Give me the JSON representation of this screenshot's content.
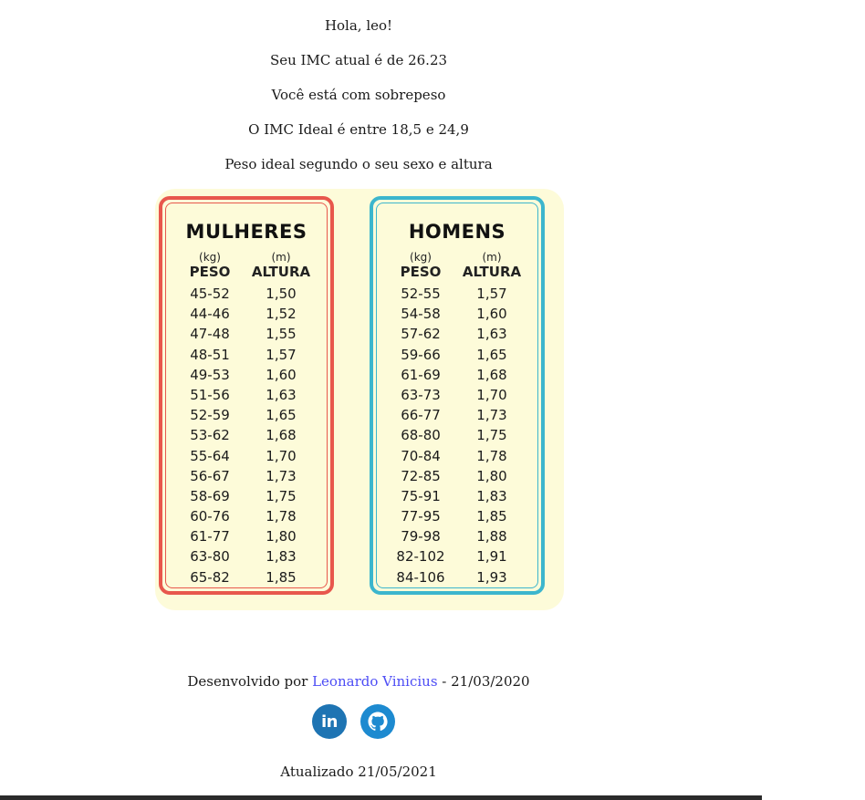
{
  "greeting": "Hola, leo!",
  "imc_text": "Seu IMC atual é de 26.23",
  "status_text": "Você está com sobrepeso",
  "ideal_range_text": "O IMC Ideal é entre 18,5 e 24,9",
  "ideal_weight_text": "Peso ideal segundo o seu sexo e altura",
  "table": {
    "women": {
      "title": "MULHERES",
      "unit_weight": "(kg)",
      "unit_height": "(m)",
      "col_weight": "PESO",
      "col_height": "ALTURA",
      "rows": [
        {
          "peso": "45-52",
          "altura": "1,50"
        },
        {
          "peso": "44-46",
          "altura": "1,52"
        },
        {
          "peso": "47-48",
          "altura": "1,55"
        },
        {
          "peso": "48-51",
          "altura": "1,57"
        },
        {
          "peso": "49-53",
          "altura": "1,60"
        },
        {
          "peso": "51-56",
          "altura": "1,63"
        },
        {
          "peso": "52-59",
          "altura": "1,65"
        },
        {
          "peso": "53-62",
          "altura": "1,68"
        },
        {
          "peso": "55-64",
          "altura": "1,70"
        },
        {
          "peso": "56-67",
          "altura": "1,73"
        },
        {
          "peso": "58-69",
          "altura": "1,75"
        },
        {
          "peso": "60-76",
          "altura": "1,78"
        },
        {
          "peso": "61-77",
          "altura": "1,80"
        },
        {
          "peso": "63-80",
          "altura": "1,83"
        },
        {
          "peso": "65-82",
          "altura": "1,85"
        }
      ]
    },
    "men": {
      "title": "HOMENS",
      "unit_weight": "(kg)",
      "unit_height": "(m)",
      "col_weight": "PESO",
      "col_height": "ALTURA",
      "rows": [
        {
          "peso": "52-55",
          "altura": "1,57"
        },
        {
          "peso": "54-58",
          "altura": "1,60"
        },
        {
          "peso": "57-62",
          "altura": "1,63"
        },
        {
          "peso": "59-66",
          "altura": "1,65"
        },
        {
          "peso": "61-69",
          "altura": "1,68"
        },
        {
          "peso": "63-73",
          "altura": "1,70"
        },
        {
          "peso": "66-77",
          "altura": "1,73"
        },
        {
          "peso": "68-80",
          "altura": "1,75"
        },
        {
          "peso": "70-84",
          "altura": "1,78"
        },
        {
          "peso": "72-85",
          "altura": "1,80"
        },
        {
          "peso": "75-91",
          "altura": "1,83"
        },
        {
          "peso": "77-95",
          "altura": "1,85"
        },
        {
          "peso": "79-98",
          "altura": "1,88"
        },
        {
          "peso": "82-102",
          "altura": "1,91"
        },
        {
          "peso": "84-106",
          "altura": "1,93"
        }
      ]
    }
  },
  "footer": {
    "developed_by": "Desenvolvido por",
    "author": "Leonardo Vinicius",
    "date_suffix": " - 21/03/2020",
    "updated": "Atualizado 21/05/2021"
  },
  "social": {
    "linkedin_icon": "linkedin-icon",
    "linkedin_label": "in",
    "github_icon": "github-icon"
  },
  "colors": {
    "women_border": "#e8574c",
    "men_border": "#3cb6cd",
    "link": "#4d4df5",
    "chart_bg": "#fdfbd9"
  }
}
